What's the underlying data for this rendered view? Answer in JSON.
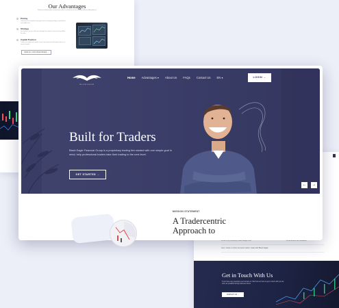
{
  "advantages_card": {
    "title": "Our Advantages",
    "subtitle": "Nonaut ut fabuli quitis inconnuit in at Ibu est, libeunt tes id vel at Eu falitaion bibendum at",
    "items": [
      {
        "title": "Pricing",
        "text": "Constant and competitive pricing for all our trading packages, paid without any hidden fees."
      },
      {
        "title": "Strategy",
        "text": "Our traders can earn with any strategy they choose so long as they follow the rules."
      },
      {
        "title": "Capital Position",
        "text": "Traders can trade with capital of up to our maximum allocation and earn a share of profits."
      }
    ],
    "button_label": "VIEW ALL OUR ADVANTAGES →"
  },
  "header": {
    "logo_text": "BLACK EAGLE",
    "nav": [
      "Home",
      "Advantages ▾",
      "About Us",
      "FAQs",
      "Contact Us",
      "EN ▾"
    ],
    "login_label": "LOGIN →"
  },
  "hero": {
    "title": "Built for Traders",
    "text": "Black Eagle Financial Group is a proprietary trading firm started with one simple goal in mind; help professional traders take their trading to the next level.",
    "cta_label": "GET STARTED →",
    "prev_icon": "arrow-left-icon",
    "next_icon": "arrow-right-icon",
    "prev_glyph": "←",
    "next_glyph": "→"
  },
  "mission": {
    "label": "MISSION STATEMENT",
    "title_line1": "A Tradercentric",
    "title_line2": "Approach to"
  },
  "faq_card": {
    "rows": [
      {
        "left": "What is a proprietary Black Eagle offer",
        "right": "What assets are available"
      },
      {
        "left": "Can I trade on other accounts while I trade with Black Eagle",
        "right": ""
      }
    ],
    "contact_title": "Get in Touch With Us",
    "contact_text": "If you have any questions just contact us. We'll do our best to get in touch with you as soon as possible during business hours.",
    "contact_button": "CONTACT US →"
  },
  "colors": {
    "hero_bg": "#3d4069",
    "contact_bg": "#1d2343",
    "page_bg": "#eceef8"
  }
}
